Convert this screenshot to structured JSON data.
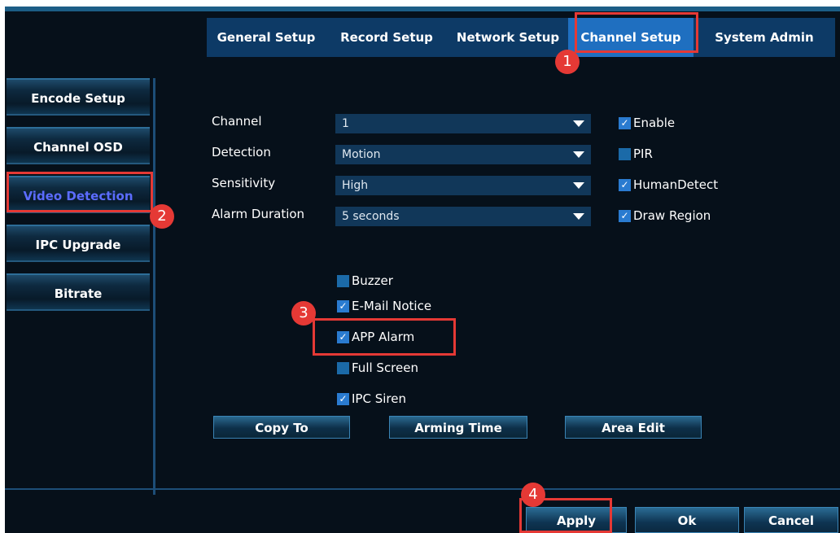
{
  "tabs": [
    {
      "label": "General Setup",
      "active": false
    },
    {
      "label": "Record Setup",
      "active": false
    },
    {
      "label": "Network Setup",
      "active": false
    },
    {
      "label": "Channel Setup",
      "active": true
    },
    {
      "label": "System Admin",
      "active": false
    }
  ],
  "sidebar": {
    "items": [
      {
        "label": "Encode Setup",
        "active": false
      },
      {
        "label": "Channel OSD",
        "active": false
      },
      {
        "label": "Video Detection",
        "active": true
      },
      {
        "label": "IPC Upgrade",
        "active": false
      },
      {
        "label": "Bitrate",
        "active": false
      }
    ]
  },
  "form": {
    "channel": {
      "label": "Channel",
      "value": "1"
    },
    "detection": {
      "label": "Detection",
      "value": "Motion"
    },
    "sensitivity": {
      "label": "Sensitivity",
      "value": "High"
    },
    "alarm_duration": {
      "label": "Alarm Duration",
      "value": "5 seconds"
    },
    "right_checks": [
      {
        "label": "Enable",
        "checked": true
      },
      {
        "label": "PIR",
        "checked": false
      },
      {
        "label": "HumanDetect",
        "checked": true
      },
      {
        "label": "Draw Region",
        "checked": true
      }
    ],
    "alarm_checks": [
      {
        "label": "Buzzer",
        "checked": false
      },
      {
        "label": "E-Mail Notice",
        "checked": true
      },
      {
        "label": "APP Alarm",
        "checked": true
      },
      {
        "label": "Full Screen",
        "checked": false
      },
      {
        "label": "IPC Siren",
        "checked": true
      }
    ]
  },
  "actions": {
    "copy_to": "Copy To",
    "arming_time": "Arming Time",
    "area_edit": "Area Edit"
  },
  "footer": {
    "apply": "Apply",
    "ok": "Ok",
    "cancel": "Cancel"
  },
  "annotations": {
    "m1": "1",
    "m2": "2",
    "m3": "3",
    "m4": "4"
  },
  "colors": {
    "annotation": "#e53935",
    "tabbar": "#0d3a66",
    "active_tab": "#1f6fc0",
    "checkbox": "#2a7bd0"
  }
}
